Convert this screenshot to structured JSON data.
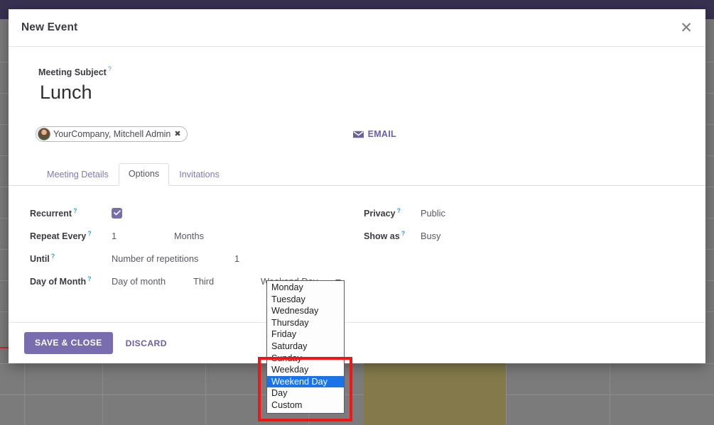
{
  "window": {
    "topbar_color": "#393150",
    "backdrop_color": "#7b7b7b"
  },
  "background": {
    "event_block_color": "#83794a",
    "now_indicator_color": "#c62828"
  },
  "modal": {
    "title": "New Event",
    "close_icon": "close-icon",
    "subject": {
      "label": "Meeting Subject",
      "help_marker": "?",
      "value": "Lunch"
    },
    "attendee": {
      "name": "YourCompany, Mitchell Admin",
      "remove_icon": "✖",
      "avatar_icon": "user-avatar"
    },
    "email_button": {
      "label": "EMAIL",
      "icon": "envelope-icon",
      "color": "#6b60a4"
    },
    "tabs": [
      {
        "label": "Meeting Details",
        "active": false
      },
      {
        "label": "Options",
        "active": true
      },
      {
        "label": "Invitations",
        "active": false
      }
    ],
    "fields_left": [
      {
        "label": "Recurrent",
        "help_marker": "?",
        "type": "checkbox",
        "checked": true
      },
      {
        "label": "Repeat Every",
        "help_marker": "?",
        "type": "pair",
        "value1": "1",
        "value2": "Months"
      },
      {
        "label": "Until",
        "help_marker": "?",
        "type": "pair",
        "value1": "Number of repetitions",
        "value2": "1"
      },
      {
        "label": "Day of Month",
        "help_marker": "?",
        "type": "triple",
        "value1": "Day of month",
        "value2": "Third",
        "value3": "Weekend Day"
      }
    ],
    "fields_right": [
      {
        "label": "Privacy",
        "help_marker": "?",
        "value": "Public"
      },
      {
        "label": "Show as",
        "help_marker": "?",
        "value": "Busy"
      }
    ],
    "footer": {
      "save_label": "SAVE & CLOSE",
      "discard_label": "DISCARD",
      "save_color": "#7a6daf"
    }
  },
  "select_popup": {
    "options": [
      {
        "label": "Monday",
        "selected": false
      },
      {
        "label": "Tuesday",
        "selected": false
      },
      {
        "label": "Wednesday",
        "selected": false
      },
      {
        "label": "Thursday",
        "selected": false
      },
      {
        "label": "Friday",
        "selected": false
      },
      {
        "label": "Saturday",
        "selected": false
      },
      {
        "label": "Sunday",
        "selected": false
      },
      {
        "label": "Weekday",
        "selected": false
      },
      {
        "label": "Weekend Day",
        "selected": true
      },
      {
        "label": "Day",
        "selected": false
      },
      {
        "label": "Custom",
        "selected": false
      }
    ],
    "highlight_color": "#1a73e8"
  },
  "annotation": {
    "color": "#f51414",
    "shape": "rectangle"
  }
}
